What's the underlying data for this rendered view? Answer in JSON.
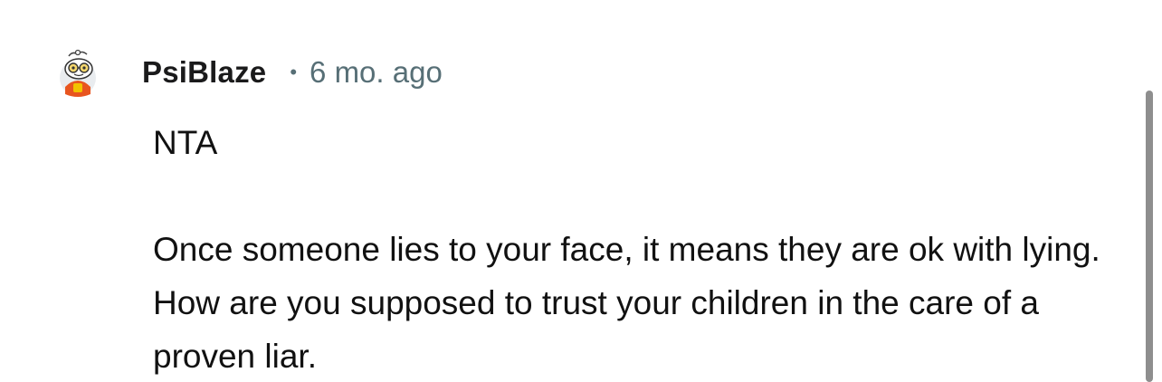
{
  "comment": {
    "author": "PsiBlaze",
    "separator": "•",
    "timestamp": "6 mo. ago",
    "avatar_icon": "snoo-avatar-icon",
    "body": [
      "NTA",
      "Once someone lies to your face, it means they are ok with lying. How are you supposed to trust your children in the care of a proven liar."
    ]
  },
  "colors": {
    "meta_gray": "#576f76",
    "text": "#111111",
    "scrollbar": "#8e8e8e"
  }
}
